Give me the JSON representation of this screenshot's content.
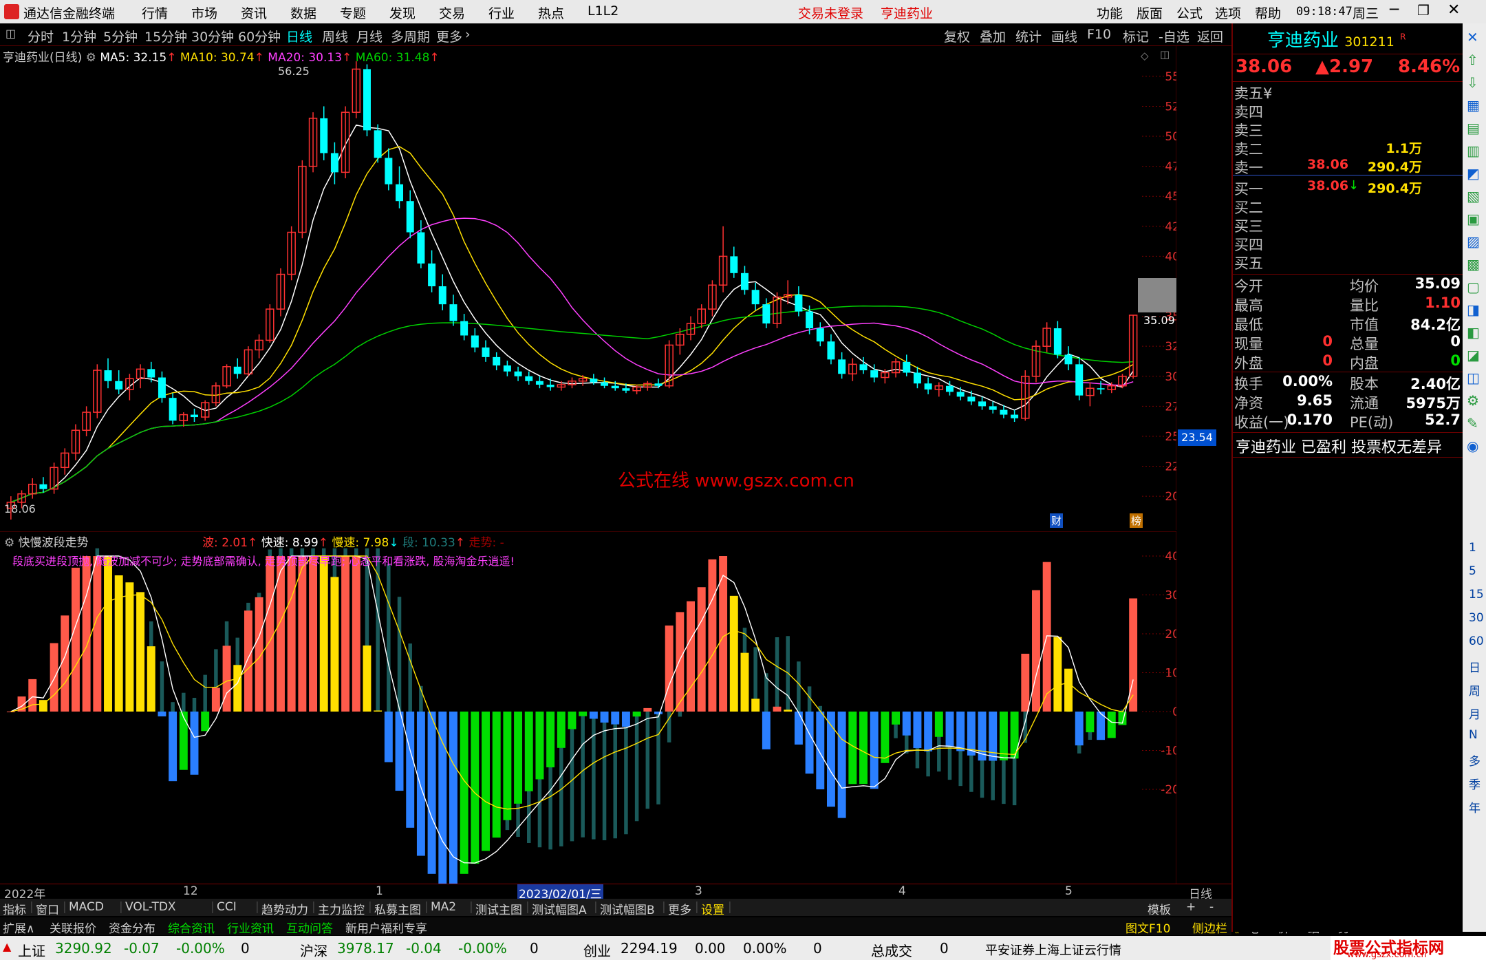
{
  "titlebar": {
    "app_name": "通达信金融终端",
    "menus": [
      "行情",
      "市场",
      "资讯",
      "数据",
      "专题",
      "发现",
      "交易",
      "行业",
      "热点",
      "L1L2"
    ],
    "login_status": "交易未登录",
    "stock_title": "亨迪药业",
    "right_menus": [
      "功能",
      "版面",
      "公式",
      "选项",
      "帮助"
    ],
    "time": "09:18:47",
    "weekday": "周三"
  },
  "periodbar": {
    "periods": [
      "分时",
      "1分钟",
      "5分钟",
      "15分钟",
      "30分钟",
      "60分钟",
      "日线",
      "周线",
      "月线",
      "多周期",
      "更多"
    ],
    "active": "日线",
    "tools": [
      "复权",
      "叠加",
      "统计",
      "画线",
      "F10",
      "标记",
      "-自选",
      "返回"
    ]
  },
  "main_chart": {
    "title": "亨迪药业(日线)",
    "ma5": "MA5: 32.15",
    "ma10": "MA10: 30.74",
    "ma20": "MA20: 30.13",
    "ma60": "MA60: 31.48",
    "high_label": "56.25",
    "low_label": "18.06",
    "current_tag": "35.09",
    "axis_tag": "23.54",
    "watermark": "公式在线  www.gszx.com.cn",
    "y_ticks": [
      "55.00",
      "52.50",
      "50.00",
      "47.50",
      "45.00",
      "42.50",
      "40.00",
      "37.50",
      "35.00",
      "32.50",
      "30.00",
      "27.50",
      "25.00",
      "22.50",
      "20.00"
    ],
    "markers": [
      "财",
      "榜"
    ]
  },
  "indicator": {
    "title": "快慢波段走势",
    "wave": "波: 2.01",
    "fast": "快速: 8.99",
    "slow": "慢速: 7.98",
    "seg": "段: 10.33",
    "trend": "走势: -",
    "slogan": "段底买进段顶抛, 随波加减不可少; 走势底部需确认, 走势顶部尽早跑; 心态平和看涨跌, 股海淘金乐逍遥!",
    "y_ticks": [
      "40.00",
      "30.00",
      "20.00",
      "10.00",
      "0.00",
      "-10.00",
      "-20.00"
    ]
  },
  "date_axis": {
    "labels": [
      "2022年",
      "12",
      "1",
      "2023/02/01/三",
      "3",
      "4",
      "5"
    ],
    "period": "日线"
  },
  "indicator_tabs": [
    "指标",
    "窗口",
    "MACD",
    "VOL-TDX",
    "CCI",
    "趋势动力",
    "主力监控",
    "私募主图",
    "MA2",
    "测试主图",
    "测试幅图A",
    "测试幅图B",
    "更多",
    "设置"
  ],
  "indicator_tabs_right": [
    "模板",
    "+",
    "-"
  ],
  "bottom_tabs": [
    "扩展∧",
    "关联报价",
    "资金分布",
    "综合资讯",
    "行业资讯",
    "互动问答",
    "新用户福利专享"
  ],
  "bottom_tabs_right": [
    "图文F10",
    "侧边栏《",
    "笔",
    "价",
    "细",
    "势"
  ],
  "quote": {
    "name": "亨迪药业",
    "code": "301211",
    "flag": "R",
    "price": "38.06",
    "change": "▲2.97",
    "pct": "8.46%",
    "asks": [
      {
        "label": "卖五",
        "price": "",
        "vol": "",
        "mark": "¥"
      },
      {
        "label": "卖四",
        "price": "",
        "vol": ""
      },
      {
        "label": "卖三",
        "price": "",
        "vol": ""
      },
      {
        "label": "卖二",
        "price": "",
        "vol": "1.1万"
      },
      {
        "label": "卖一",
        "price": "38.06",
        "vol": "290.4万"
      }
    ],
    "bids": [
      {
        "label": "买一",
        "price": "38.06",
        "vol": "290.4万",
        "mark": "↓"
      },
      {
        "label": "买二",
        "price": "",
        "vol": ""
      },
      {
        "label": "买三",
        "price": "",
        "vol": ""
      },
      {
        "label": "买四",
        "price": "",
        "vol": ""
      },
      {
        "label": "买五",
        "price": "",
        "vol": ""
      }
    ],
    "stats": [
      [
        "今开",
        "",
        "均价",
        "35.09"
      ],
      [
        "最高",
        "",
        "量比",
        "1.10"
      ],
      [
        "最低",
        "",
        "市值",
        "84.2亿"
      ],
      [
        "现量",
        "0",
        "总量",
        "0"
      ],
      [
        "外盘",
        "0",
        "内盘",
        "0"
      ]
    ],
    "stats2": [
      [
        "换手",
        "0.00%",
        "股本",
        "2.40亿"
      ],
      [
        "净资",
        "9.65",
        "流通",
        "5975万"
      ],
      [
        "收益(一)",
        "0.170",
        "PE(动)",
        "52.7"
      ]
    ],
    "news": "亨迪药业 已盈利 投票权无差异"
  },
  "sidebar_labels": [
    "1",
    "5",
    "15",
    "30",
    "60",
    "日",
    "周",
    "月",
    "N",
    "多",
    "季",
    "年"
  ],
  "statusbar": {
    "sh_name": "上证",
    "sh_val": "3290.92",
    "sh_chg": "-0.07",
    "sh_pct": "-0.00%",
    "hs_name": "沪深",
    "hs_val": "3978.17",
    "hs_chg": "-0.04",
    "hs_pct": "-0.00%",
    "hs_vol": "0",
    "cy_name": "创业",
    "cy_val": "2294.19",
    "cy_chg": "0.00",
    "cy_pct": "0.00%",
    "cy_vol": "0",
    "total_name": "总成交",
    "total_val": "0",
    "broker": "平安证券上海上证云行情",
    "sh_vol": "0",
    "brand": "股票公式指标网",
    "brand_url": "www.gszx.com.cn"
  },
  "chart_data": {
    "type": "candlestick",
    "ylim": [
      18,
      57
    ],
    "candles": [
      [
        19.0,
        20.0,
        18.06,
        19.5
      ],
      [
        19.5,
        20.5,
        19.0,
        20.2
      ],
      [
        20.2,
        21.5,
        19.8,
        21.0
      ],
      [
        21.0,
        21.6,
        20.3,
        20.6
      ],
      [
        20.6,
        22.8,
        20.2,
        22.4
      ],
      [
        22.4,
        24.0,
        21.8,
        23.6
      ],
      [
        23.6,
        26.0,
        23.0,
        25.5
      ],
      [
        25.5,
        27.5,
        25.0,
        27.0
      ],
      [
        27.0,
        31.0,
        26.5,
        30.5
      ],
      [
        30.5,
        31.5,
        29.0,
        29.6
      ],
      [
        29.6,
        30.5,
        28.5,
        28.9
      ],
      [
        28.9,
        30.2,
        28.0,
        29.8
      ],
      [
        29.8,
        31.0,
        29.0,
        30.6
      ],
      [
        30.6,
        31.2,
        29.5,
        29.9
      ],
      [
        29.9,
        30.4,
        27.8,
        28.2
      ],
      [
        28.2,
        28.6,
        26.0,
        26.3
      ],
      [
        26.3,
        27.0,
        25.8,
        26.8
      ],
      [
        26.8,
        27.3,
        26.2,
        26.6
      ],
      [
        26.6,
        28.0,
        26.3,
        27.8
      ],
      [
        27.8,
        29.5,
        27.5,
        29.2
      ],
      [
        29.2,
        31.0,
        29.0,
        30.8
      ],
      [
        30.8,
        31.5,
        29.8,
        30.2
      ],
      [
        30.2,
        32.5,
        30.0,
        32.2
      ],
      [
        32.2,
        33.5,
        31.5,
        33.0
      ],
      [
        33.0,
        36.0,
        32.8,
        35.6
      ],
      [
        35.6,
        39.0,
        35.0,
        38.5
      ],
      [
        38.5,
        42.5,
        38.0,
        42.0
      ],
      [
        42.0,
        48.0,
        41.5,
        47.5
      ],
      [
        47.5,
        52.0,
        47.0,
        51.5
      ],
      [
        51.5,
        52.5,
        48.0,
        48.6
      ],
      [
        48.6,
        49.5,
        46.0,
        47.0
      ],
      [
        47.0,
        52.5,
        46.5,
        52.0
      ],
      [
        52.0,
        56.25,
        51.5,
        55.6
      ],
      [
        55.6,
        56.0,
        50.0,
        50.5
      ],
      [
        50.5,
        51.0,
        47.8,
        48.2
      ],
      [
        48.2,
        49.0,
        45.5,
        46.0
      ],
      [
        46.0,
        47.5,
        44.0,
        44.6
      ],
      [
        44.6,
        45.5,
        41.5,
        42.0
      ],
      [
        42.0,
        43.0,
        39.0,
        39.4
      ],
      [
        39.4,
        40.5,
        37.0,
        37.5
      ],
      [
        37.5,
        38.5,
        35.5,
        36.0
      ],
      [
        36.0,
        36.8,
        34.2,
        34.6
      ],
      [
        34.6,
        35.2,
        33.0,
        33.4
      ],
      [
        33.4,
        34.0,
        32.0,
        32.4
      ],
      [
        32.4,
        33.0,
        31.2,
        31.6
      ],
      [
        31.6,
        32.0,
        30.5,
        30.9
      ],
      [
        30.9,
        31.3,
        30.0,
        30.4
      ],
      [
        30.4,
        30.8,
        29.6,
        30.0
      ],
      [
        30.0,
        30.4,
        29.3,
        29.6
      ],
      [
        29.6,
        30.0,
        29.0,
        29.3
      ],
      [
        29.3,
        29.8,
        28.8,
        29.1
      ],
      [
        29.1,
        29.6,
        28.8,
        29.3
      ],
      [
        29.3,
        29.9,
        29.0,
        29.6
      ],
      [
        29.6,
        30.1,
        29.2,
        29.8
      ],
      [
        29.8,
        30.2,
        29.3,
        29.5
      ],
      [
        29.5,
        29.9,
        29.0,
        29.2
      ],
      [
        29.2,
        29.6,
        28.8,
        29.0
      ],
      [
        29.0,
        29.4,
        28.6,
        28.8
      ],
      [
        28.8,
        29.3,
        28.5,
        29.1
      ],
      [
        29.1,
        29.6,
        28.8,
        29.4
      ],
      [
        29.4,
        29.8,
        29.0,
        29.2
      ],
      [
        29.2,
        33.0,
        29.0,
        32.6
      ],
      [
        32.6,
        34.0,
        31.8,
        33.5
      ],
      [
        33.5,
        35.0,
        33.0,
        34.4
      ],
      [
        34.4,
        36.0,
        34.0,
        35.6
      ],
      [
        35.6,
        38.0,
        35.0,
        37.6
      ],
      [
        37.6,
        42.5,
        37.0,
        40.0
      ],
      [
        40.0,
        40.8,
        38.2,
        38.6
      ],
      [
        38.6,
        39.2,
        36.8,
        37.2
      ],
      [
        37.2,
        37.8,
        35.5,
        36.0
      ],
      [
        36.0,
        36.5,
        34.0,
        34.4
      ],
      [
        34.4,
        37.0,
        34.0,
        36.6
      ],
      [
        36.6,
        38.0,
        36.0,
        36.8
      ],
      [
        36.8,
        37.5,
        35.0,
        35.4
      ],
      [
        35.4,
        35.9,
        33.5,
        34.0
      ],
      [
        34.0,
        34.5,
        32.5,
        32.9
      ],
      [
        32.9,
        33.5,
        31.0,
        31.4
      ],
      [
        31.4,
        32.0,
        29.8,
        30.2
      ],
      [
        30.2,
        31.5,
        29.6,
        31.0
      ],
      [
        31.0,
        31.6,
        30.2,
        30.5
      ],
      [
        30.5,
        31.0,
        29.5,
        29.9
      ],
      [
        29.9,
        30.6,
        29.4,
        30.3
      ],
      [
        30.3,
        31.5,
        29.9,
        31.2
      ],
      [
        31.2,
        31.8,
        30.0,
        30.3
      ],
      [
        30.3,
        30.8,
        29.0,
        29.4
      ],
      [
        29.4,
        29.9,
        28.5,
        28.9
      ],
      [
        28.9,
        29.5,
        28.3,
        29.2
      ],
      [
        29.2,
        29.6,
        28.4,
        28.7
      ],
      [
        28.7,
        29.1,
        28.0,
        28.3
      ],
      [
        28.3,
        28.8,
        27.6,
        27.9
      ],
      [
        27.9,
        28.3,
        27.2,
        27.5
      ],
      [
        27.5,
        27.9,
        26.9,
        27.2
      ],
      [
        27.2,
        27.6,
        26.5,
        26.8
      ],
      [
        26.8,
        27.2,
        26.2,
        26.5
      ],
      [
        26.5,
        30.5,
        26.3,
        30.0
      ],
      [
        30.0,
        33.0,
        29.5,
        32.5
      ],
      [
        32.5,
        34.5,
        32.0,
        34.0
      ],
      [
        34.0,
        34.6,
        31.5,
        31.8
      ],
      [
        31.8,
        32.5,
        30.5,
        31.0
      ],
      [
        31.0,
        31.6,
        28.0,
        28.4
      ],
      [
        28.4,
        29.5,
        27.5,
        29.0
      ],
      [
        29.0,
        29.6,
        28.5,
        28.9
      ],
      [
        28.9,
        29.5,
        28.6,
        29.2
      ],
      [
        29.2,
        30.2,
        29.0,
        30.0
      ],
      [
        30.0,
        35.09,
        29.8,
        35.09
      ]
    ]
  }
}
